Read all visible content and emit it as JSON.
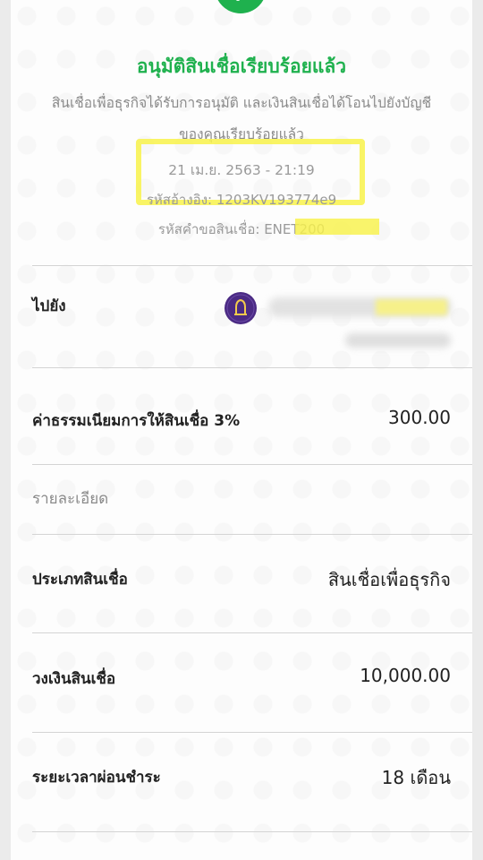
{
  "status": {
    "title": "อนุมัติสินเชื่อเรียบร้อยแล้ว",
    "description_line1": "สินเชื่อเพื่อธุรกิจได้รับการอนุมัติ และเงินสินเชื่อได้โอนไปยังบัญชี",
    "description_line2": "ของคุณเรียบร้อยแล้ว",
    "datetime": "21 เม.ย. 2563 - 21:19",
    "reference": "รหัสอ้างอิง: 1203KV193774e9",
    "request_id": "รหัสคำขอสินเชื่อ: ENET200",
    "success_color": "#1fb14e"
  },
  "transfer": {
    "to_label": "ไปยัง",
    "bank_icon": "scb-bank-icon",
    "bank_color": "#4b2a84"
  },
  "fee": {
    "label": "ค่าธรรมเนียมการให้สินเชื่อ 3%",
    "value": "300.00"
  },
  "details": {
    "section_label": "รายละเอียด",
    "rows": [
      {
        "label": "ประเภทสินเชื่อ",
        "value": "สินเชื่อเพื่อธุรกิจ"
      },
      {
        "label": "วงเงินสินเชื่อ",
        "value": "10,000.00"
      },
      {
        "label": "ระยะเวลาผ่อนชำระ",
        "value": "18 เดือน"
      }
    ]
  },
  "icons": {
    "check": "check-icon"
  }
}
